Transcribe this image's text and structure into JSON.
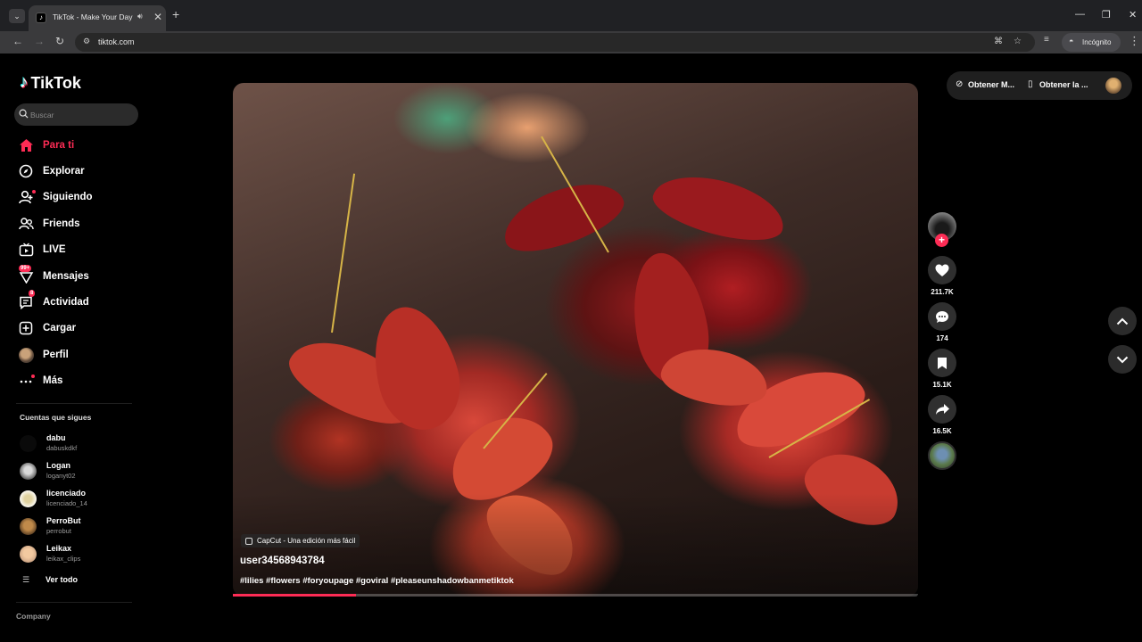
{
  "browser": {
    "tab_title": "TikTok - Make Your Day",
    "url": "tiktok.com",
    "incognito_label": "Incógnito",
    "new_tab": "+",
    "close": "✕"
  },
  "app": {
    "logo_text": "TikTok",
    "search_placeholder": "Buscar",
    "brand_color": "#fe2c55"
  },
  "sidebar": {
    "items": [
      {
        "label": "Para ti",
        "icon": "home-icon",
        "active": true
      },
      {
        "label": "Explorar",
        "icon": "compass-icon"
      },
      {
        "label": "Siguiendo",
        "icon": "user-follow-icon"
      },
      {
        "label": "Friends",
        "icon": "friends-icon"
      },
      {
        "label": "LIVE",
        "icon": "live-tv-icon"
      },
      {
        "label": "Mensajes",
        "icon": "message-icon",
        "badge": "99+"
      },
      {
        "label": "Actividad",
        "icon": "activity-icon",
        "badge": "8"
      },
      {
        "label": "Cargar",
        "icon": "upload-icon"
      },
      {
        "label": "Perfil",
        "icon": "profile-avatar"
      },
      {
        "label": "Más",
        "icon": "more-icon"
      }
    ],
    "following_title": "Cuentas que sigues",
    "following": [
      {
        "name": "dabu",
        "handle": "dabuskdkf"
      },
      {
        "name": "Logan",
        "handle": "loganyt02"
      },
      {
        "name": "licenciado",
        "handle": "licenciado_14"
      },
      {
        "name": "PerroBut",
        "handle": "perrobut"
      },
      {
        "name": "Leikax",
        "handle": "leikax_clips"
      }
    ],
    "see_all": "Ver todo",
    "company": "Company"
  },
  "video": {
    "effect_label": "CapCut - Una edición más fácil",
    "author": "user34568943784",
    "caption": "#lilies #flowers #foryoupage #goviral #pleaseunshadowbanmetiktok",
    "progress": 0.18
  },
  "actions": {
    "likes": "211.7K",
    "comments": "174",
    "saves": "15.1K",
    "shares": "16.5K"
  },
  "top_actions": {
    "get_coins": "Obtener M...",
    "get_app": "Obtener la ..."
  }
}
